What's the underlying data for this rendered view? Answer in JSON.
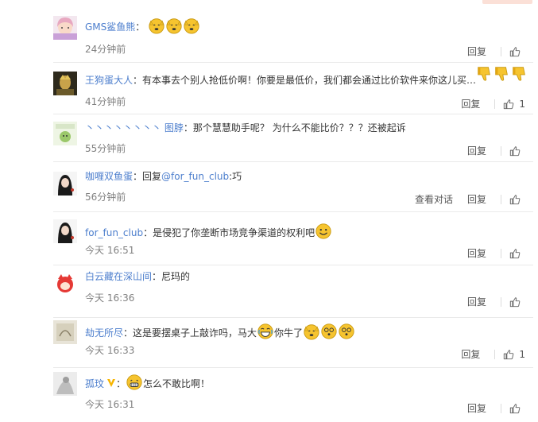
{
  "comments": [
    {
      "user": "GMS鲨鱼熊",
      "sep": "：",
      "text": "",
      "text2": "",
      "time": "24分钟前",
      "reply": "回复",
      "like_count": ""
    },
    {
      "user": "王狗蛋大人",
      "sep": "：",
      "text": "有本事去个别人抢低价啊！你要是最低价，我们都会通过比价软件来你这儿买…",
      "text2": "",
      "time": "41分钟前",
      "reply": "回复",
      "like_count": "1"
    },
    {
      "prefix": "丶丶丶丶丶丶丶丶",
      "user": "图脖",
      "sep": "：",
      "text": "那个慧慧助手呢？ 为什么不能比价？？？还被起诉",
      "text2": "",
      "time": "55分钟前",
      "reply": "回复",
      "like_count": ""
    },
    {
      "user": "咖喱双鱼蛋",
      "sep": "：",
      "text": "回复",
      "mention": "@for_fun_club",
      "text_after": ":巧",
      "time": "56分钟前",
      "view_conversation": "查看对话",
      "reply": "回复",
      "like_count": ""
    },
    {
      "user": "for_fun_club",
      "sep": "：",
      "text": "是侵犯了你垄断市场竞争渠道的权利吧",
      "text2": "",
      "time": "今天 16:51",
      "reply": "回复",
      "like_count": ""
    },
    {
      "user": "白云藏在深山间",
      "sep": "：",
      "text": "尼玛的",
      "text2": "",
      "time": "今天 16:36",
      "reply": "回复",
      "like_count": ""
    },
    {
      "user": "劫无所尽",
      "sep": "：",
      "text": "这是要摆桌子上敲诈吗，马大",
      "text2": "你牛了",
      "time": "今天 16:33",
      "reply": "回复",
      "like_count": "1"
    },
    {
      "user": "孤玟",
      "sep": "：",
      "text": "",
      "text2": "怎么不敢比啊！",
      "time": "今天 16:31",
      "reply": "回复",
      "like_count": ""
    }
  ],
  "colors": {
    "link": "#4c7ecd",
    "time": "#808080",
    "emoji_yellow": "#f6c42f",
    "vip": "#f7b500"
  }
}
